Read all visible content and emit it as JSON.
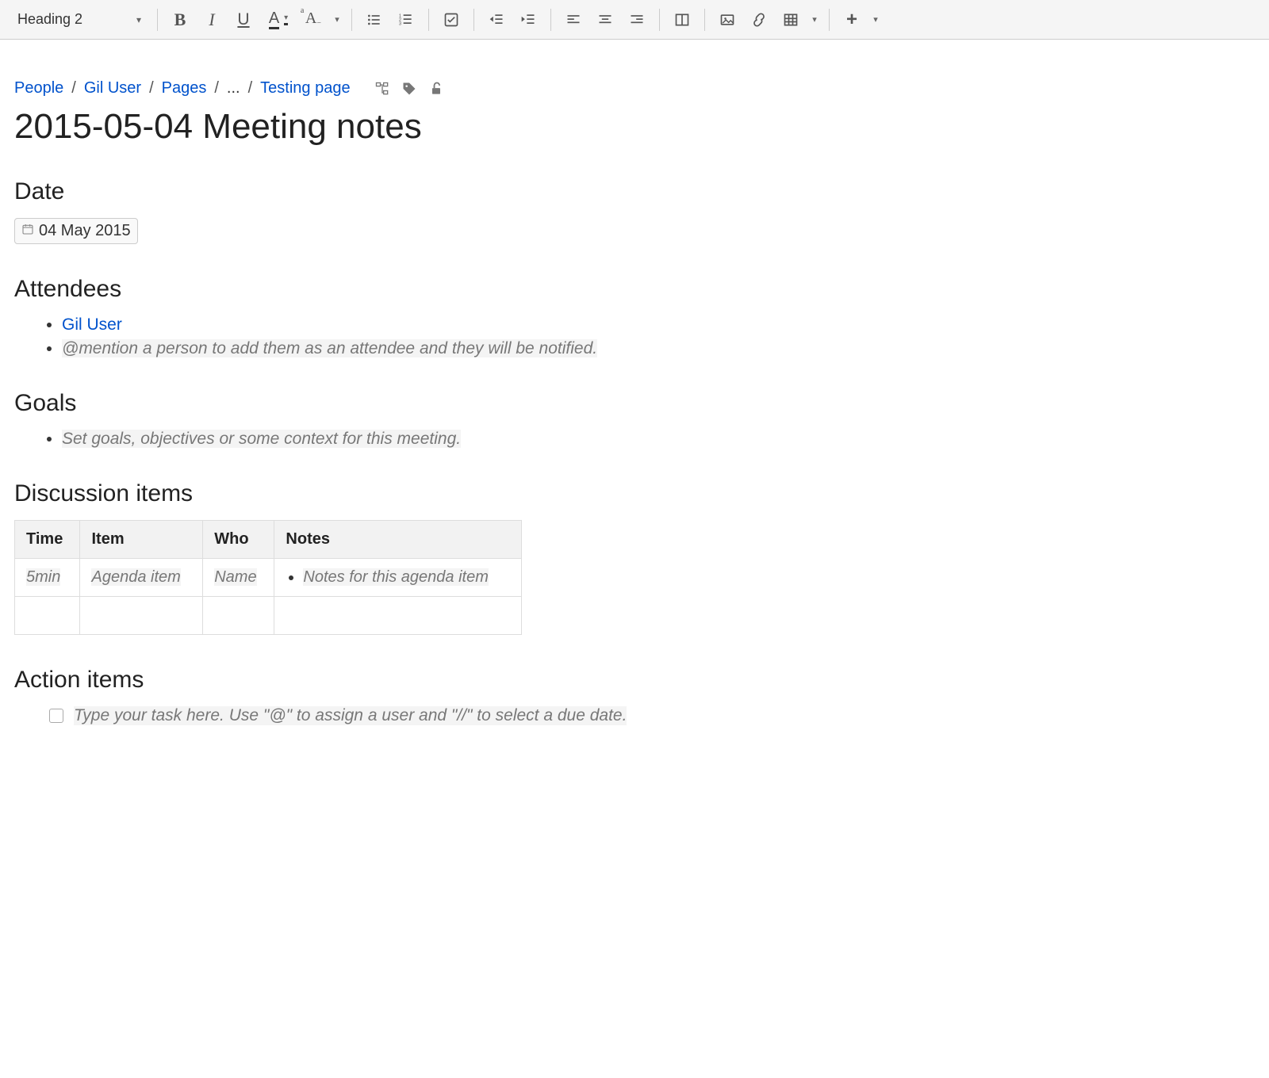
{
  "toolbar": {
    "style_dropdown": "Heading 2"
  },
  "breadcrumb": {
    "items": [
      "People",
      "Gil User",
      "Pages",
      "...",
      "Testing page"
    ]
  },
  "page": {
    "title": "2015-05-04 Meeting notes"
  },
  "sections": {
    "date": {
      "heading": "Date",
      "value": "04 May 2015"
    },
    "attendees": {
      "heading": "Attendees",
      "list": [
        "Gil User"
      ],
      "placeholder": "@mention a person to add them as an attendee and they will be notified."
    },
    "goals": {
      "heading": "Goals",
      "placeholder": "Set goals, objectives or some context for this meeting."
    },
    "discussion": {
      "heading": "Discussion items",
      "columns": [
        "Time",
        "Item",
        "Who",
        "Notes"
      ],
      "rows": [
        {
          "time": "5min",
          "item": "Agenda item",
          "who": "Name",
          "notes": "Notes for this agenda item"
        }
      ]
    },
    "action": {
      "heading": "Action items",
      "placeholder": "Type your task here. Use \"@\" to assign a user and \"//\" to select a due date."
    }
  }
}
